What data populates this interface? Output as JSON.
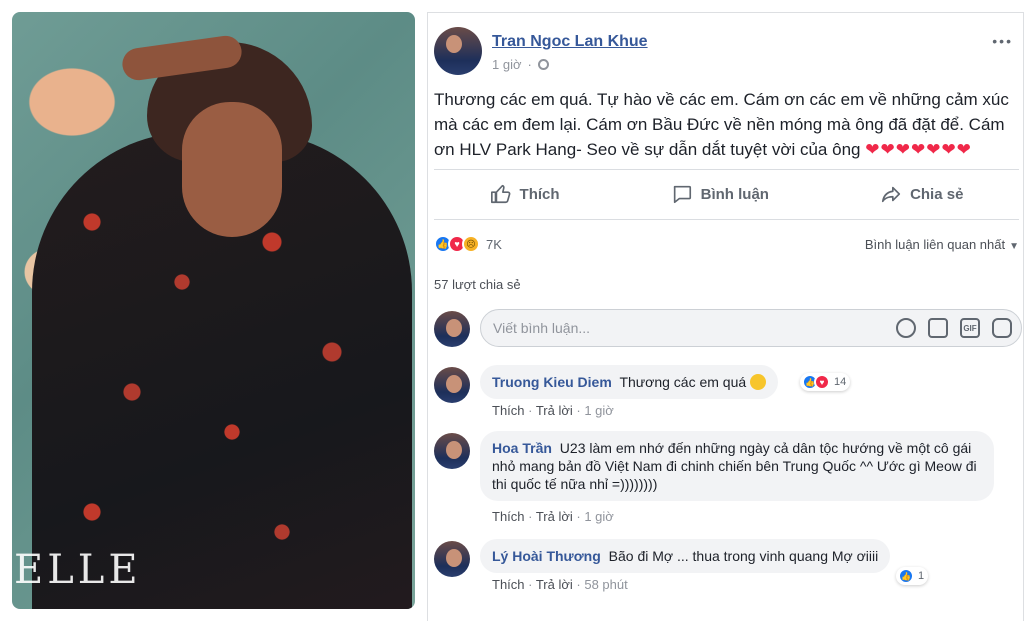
{
  "photo": {
    "logo_text": "ELLE"
  },
  "post": {
    "author": "Tran Ngoc Lan Khue",
    "time": "1 giờ",
    "text": "Thương các em quá. Tự hào về các em. Cám ơn các em về những cảm xúc mà các em đem lại. Cám ơn Bầu Đức về nền móng mà ông đã đặt để. Cám ơn HLV Park Hang- Seo về sự dẫn dắt tuyệt vời của ông",
    "hearts": "❤❤❤❤❤❤❤",
    "more_label": "•••"
  },
  "actions": {
    "like": "Thích",
    "comment": "Bình luận",
    "share": "Chia sẻ"
  },
  "reactions": {
    "count": "7K",
    "sort_label": "Bình luận liên quan nhất"
  },
  "shares": "57 lượt chia sẻ",
  "composer": {
    "placeholder": "Viết bình luận..."
  },
  "comments": [
    {
      "name": "Truong Kieu Diem",
      "text": "Thương các em quá",
      "like": "Thích",
      "reply": "Trả lời",
      "time": "1 giờ",
      "reaction_count": "14"
    },
    {
      "name": "Hoa Trần",
      "text": "U23 làm em nhớ đến những ngày cả dân tộc hướng về một cô gái nhỏ mang bản đồ Việt Nam đi chinh chiến bên Trung Quốc ^^ Ước gì Meow đi thi quốc tế nữa nhỉ =))))))))",
      "like": "Thích",
      "reply": "Trả lời",
      "time": "1 giờ"
    },
    {
      "name": "Lý Hoài Thương",
      "text": "Bão đi Mợ ... thua trong vinh quang Mợ ơiiii",
      "like": "Thích",
      "reply": "Trả lời",
      "time": "58 phút",
      "reaction_count": "1"
    }
  ],
  "colors": {
    "link": "#365899",
    "like": "#1877f2",
    "love": "#f02849"
  }
}
